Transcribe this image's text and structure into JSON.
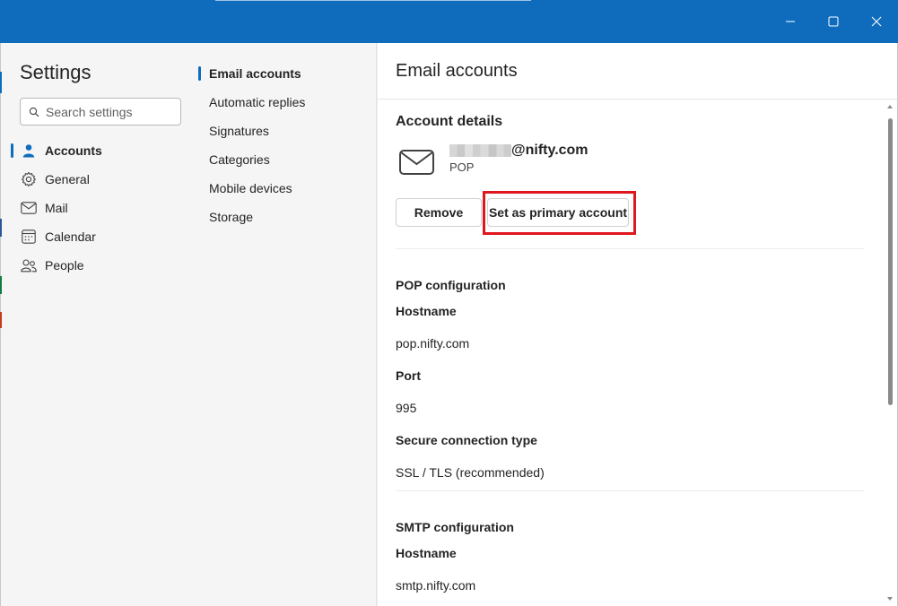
{
  "window": {
    "controls": [
      "minimize",
      "maximize",
      "close"
    ]
  },
  "nav": {
    "title": "Settings",
    "search_placeholder": "Search settings",
    "items": [
      {
        "label": "Accounts",
        "icon": "person-icon",
        "active": true
      },
      {
        "label": "General",
        "icon": "gear-icon",
        "active": false
      },
      {
        "label": "Mail",
        "icon": "mail-icon",
        "active": false
      },
      {
        "label": "Calendar",
        "icon": "calendar-icon",
        "active": false
      },
      {
        "label": "People",
        "icon": "people-icon",
        "active": false
      }
    ]
  },
  "subnav": {
    "items": [
      {
        "label": "Email accounts",
        "active": true
      },
      {
        "label": "Automatic replies",
        "active": false
      },
      {
        "label": "Signatures",
        "active": false
      },
      {
        "label": "Categories",
        "active": false
      },
      {
        "label": "Mobile devices",
        "active": false
      },
      {
        "label": "Storage",
        "active": false
      }
    ]
  },
  "content": {
    "title": "Email accounts",
    "account_details": {
      "heading": "Account details",
      "email_domain": "@nifty.com",
      "type": "POP",
      "remove_label": "Remove",
      "primary_label": "Set as primary account"
    },
    "pop": {
      "heading": "POP configuration",
      "hostname_label": "Hostname",
      "hostname_value": "pop.nifty.com",
      "port_label": "Port",
      "port_value": "995",
      "secure_label": "Secure connection type",
      "secure_value": "SSL / TLS (recommended)"
    },
    "smtp": {
      "heading": "SMTP configuration",
      "hostname_label": "Hostname",
      "hostname_value": "smtp.nifty.com"
    }
  },
  "colors": {
    "titlebar": "#0f6cbd",
    "accent": "#0f6cbd",
    "highlight": "#e0161f"
  }
}
